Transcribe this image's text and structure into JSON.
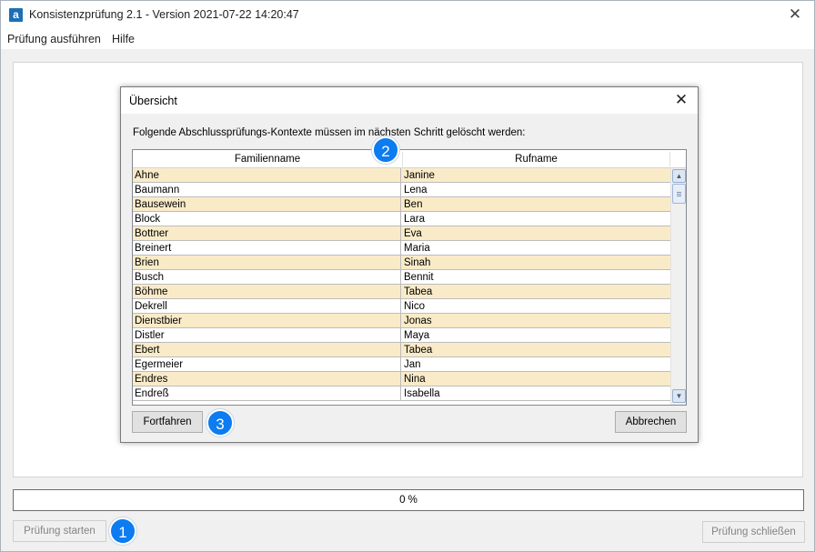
{
  "window": {
    "title": "Konsistenzprüfung 2.1 - Version 2021-07-22 14:20:47",
    "app_icon_letter": "a",
    "close_glyph": "✕"
  },
  "menu": {
    "items": [
      "Prüfung ausführen",
      "Hilfe"
    ]
  },
  "progress": {
    "value_percent": 0,
    "label": "0 %"
  },
  "buttons": {
    "start": "Prüfung starten",
    "close_check": "Prüfung schließen"
  },
  "badges": {
    "one": "1",
    "two": "2",
    "three": "3"
  },
  "dialog": {
    "title": "Übersicht",
    "close_glyph": "✕",
    "message": "Folgende Abschlussprüfungs-Kontexte müssen im nächsten Schritt gelöscht werden:",
    "columns": [
      "Familienname",
      "Rufname"
    ],
    "rows": [
      {
        "familienname": "Ahne",
        "rufname": "Janine"
      },
      {
        "familienname": "Baumann",
        "rufname": "Lena"
      },
      {
        "familienname": "Bausewein",
        "rufname": "Ben"
      },
      {
        "familienname": "Block",
        "rufname": "Lara"
      },
      {
        "familienname": "Bottner",
        "rufname": "Eva"
      },
      {
        "familienname": "Breinert",
        "rufname": "Maria"
      },
      {
        "familienname": "Brien",
        "rufname": "Sinah"
      },
      {
        "familienname": "Busch",
        "rufname": "Bennit"
      },
      {
        "familienname": "Böhme",
        "rufname": "Tabea"
      },
      {
        "familienname": "Dekrell",
        "rufname": "Nico"
      },
      {
        "familienname": "Dienstbier",
        "rufname": "Jonas"
      },
      {
        "familienname": "Distler",
        "rufname": "Maya"
      },
      {
        "familienname": "Ebert",
        "rufname": "Tabea"
      },
      {
        "familienname": "Egermeier",
        "rufname": "Jan"
      },
      {
        "familienname": "Endres",
        "rufname": "Nina"
      },
      {
        "familienname": "Endreß",
        "rufname": "Isabella"
      }
    ],
    "continue_label": "Fortfahren",
    "cancel_label": "Abbrechen"
  },
  "colors": {
    "row_highlight": "#f9ebc8",
    "badge": "#0c7cf0",
    "app_icon": "#1d6fb5"
  },
  "icons": {
    "app": "app-logo-icon",
    "close": "close-icon",
    "scroll_up": "chevron-up-icon",
    "scroll_down": "chevron-down-icon"
  }
}
